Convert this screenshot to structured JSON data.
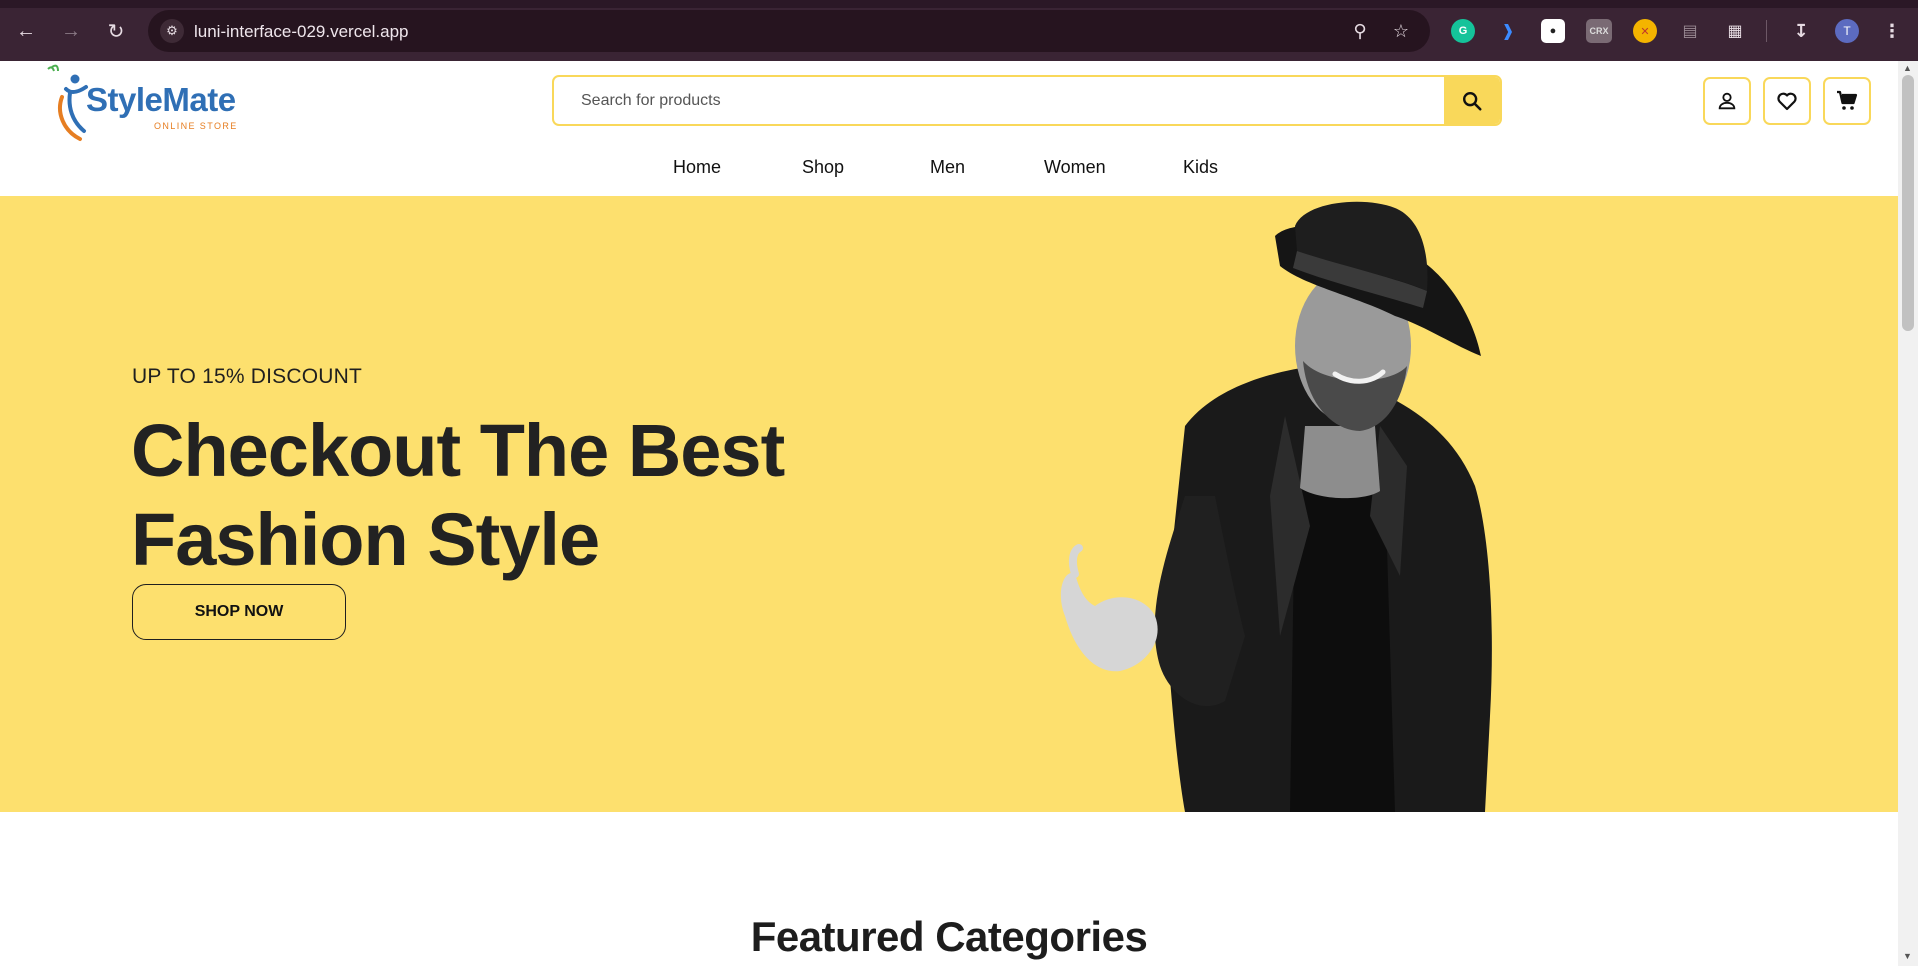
{
  "browser": {
    "url": "luni-interface-029.vercel.app",
    "profile_initial": "T",
    "extensions": [
      "grammarly-icon",
      "voice-icon",
      "mic-icon",
      "crx-icon",
      "tab-icon",
      "pages-icon",
      "extensions-icon"
    ],
    "crx_label": "CRX"
  },
  "header": {
    "logo": {
      "brand": "StyleMate",
      "tagline": "ONLINE STORE"
    },
    "search": {
      "placeholder": "Search for products"
    },
    "actions": [
      "account-icon",
      "wishlist-icon",
      "cart-icon"
    ]
  },
  "nav": {
    "items": [
      {
        "label": "Home"
      },
      {
        "label": "Shop"
      },
      {
        "label": "Men"
      },
      {
        "label": "Women"
      },
      {
        "label": "Kids"
      }
    ]
  },
  "hero": {
    "eyebrow": "UP TO 15% DISCOUNT",
    "headline_line1": "Checkout The Best",
    "headline_line2": "Fashion Style",
    "cta": "SHOP NOW"
  },
  "featured": {
    "title": "Featured Categories"
  },
  "colors": {
    "accent": "#fde06e",
    "accent_border": "#f9d85a",
    "chrome": "#3a2434",
    "brand_blue": "#2f6fb5",
    "brand_orange": "#e67e22"
  }
}
